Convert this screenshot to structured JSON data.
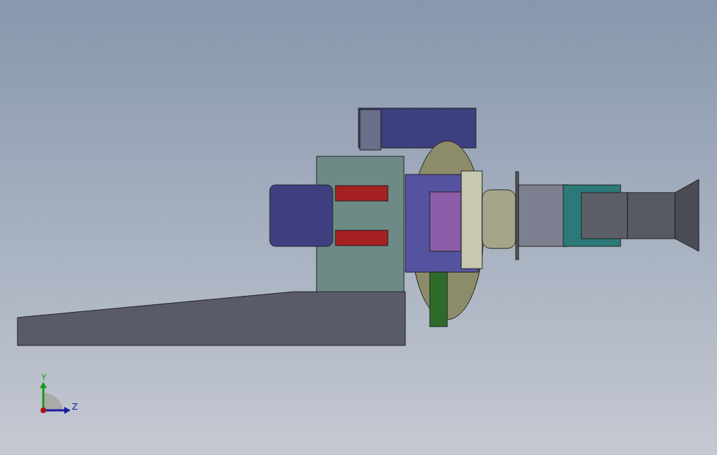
{
  "viewport": {
    "triad": {
      "y_label": "Y",
      "z_label": "Z"
    }
  }
}
